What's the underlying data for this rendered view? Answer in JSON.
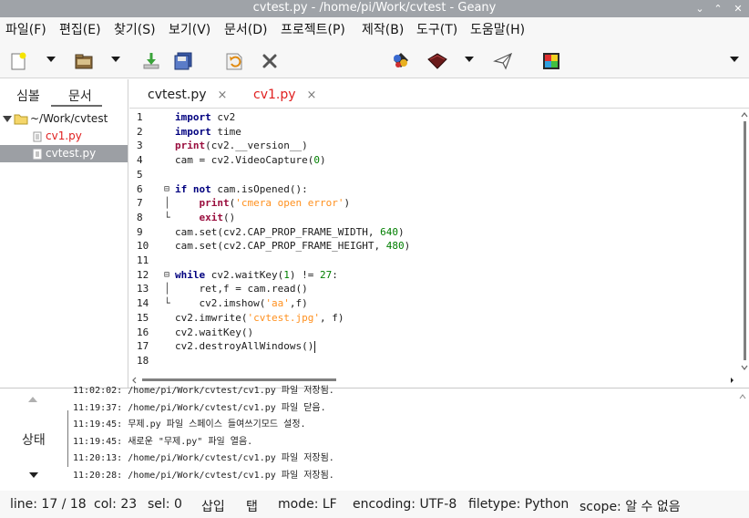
{
  "window": {
    "title": "cvtest.py - /home/pi/Work/cvtest - Geany",
    "minimize": "⌄",
    "maximize": "⌃",
    "close": "✕"
  },
  "menu": {
    "file": "파일(F)",
    "edit": "편집(E)",
    "search": "찾기(S)",
    "view": "보기(V)",
    "document": "문서(D)",
    "project": "프로젝트(P)",
    "build": "제작(B)",
    "tools": "도구(T)",
    "help": "도움말(H)"
  },
  "toolbar": {
    "icons": [
      "new-file-icon",
      "open-file-icon",
      "save-icon",
      "save-all-icon",
      "revert-icon",
      "close-file-icon",
      "compile-icon",
      "build-icon",
      "execute-icon",
      "color-chooser-icon"
    ]
  },
  "sidebar": {
    "tabs": [
      "심볼",
      "문서"
    ],
    "folder": "~/Work/cvtest",
    "files": [
      "cv1.py",
      "cvtest.py"
    ]
  },
  "editor": {
    "tabs": [
      {
        "label": "cvtest.py",
        "close": "×"
      },
      {
        "label": "cv1.py",
        "close": "×"
      }
    ],
    "lines": [
      {
        "n": "1",
        "t": "import cv2"
      },
      {
        "n": "2",
        "t": "import time"
      },
      {
        "n": "3",
        "t": "print(cv2.__version__)"
      },
      {
        "n": "4",
        "t": "cam = cv2.VideoCapture(0)"
      },
      {
        "n": "5",
        "t": ""
      },
      {
        "n": "6",
        "t": "if not cam.isOpened():"
      },
      {
        "n": "7",
        "t": "    print('cmera open error')"
      },
      {
        "n": "8",
        "t": "    exit()"
      },
      {
        "n": "9",
        "t": "cam.set(cv2.CAP_PROP_FRAME_WIDTH, 640)"
      },
      {
        "n": "10",
        "t": "cam.set(cv2.CAP_PROP_FRAME_HEIGHT, 480)"
      },
      {
        "n": "11",
        "t": ""
      },
      {
        "n": "12",
        "t": "while cv2.waitKey(1) != 27:"
      },
      {
        "n": "13",
        "t": "    ret,f = cam.read()"
      },
      {
        "n": "14",
        "t": "    cv2.imshow('aa',f)"
      },
      {
        "n": "15",
        "t": "cv2.imwrite('cvtest.jpg', f)"
      },
      {
        "n": "16",
        "t": "cv2.waitKey()"
      },
      {
        "n": "17",
        "t": "cv2.destroyAllWindows()"
      },
      {
        "n": "18",
        "t": ""
      }
    ]
  },
  "messages": {
    "tab_label": "상태",
    "rows": [
      "11:02:02: /home/pi/Work/cvtest/cv1.py 파일 저장됨.",
      "11:19:37: /home/pi/Work/cvtest/cv1.py 파일 닫음.",
      "11:19:45: 무제.py 파일 스페이스 들여쓰기모드 설정.",
      "11:19:45: 새로운 \"무제.py\" 파일 열음.",
      "11:20:13: /home/pi/Work/cvtest/cv1.py 파일 저장됨.",
      "11:20:28: /home/pi/Work/cvtest/cv1.py 파일 저장됨."
    ]
  },
  "status": {
    "line": "line: 17 / 18",
    "col": "col: 23",
    "sel": "sel: 0",
    "insert": "삽입",
    "tab": "탭",
    "mode": "mode: LF",
    "encoding": "encoding: UTF-8",
    "filetype": "filetype: Python",
    "scope": "scope: 알 수 없음"
  },
  "colors": {
    "keyword": "#00007f",
    "builtin": "#9a0e3e",
    "string": "#ff901e",
    "number": "#007f00",
    "active_tab": "#e02020",
    "selection": "#9c9fa4"
  }
}
